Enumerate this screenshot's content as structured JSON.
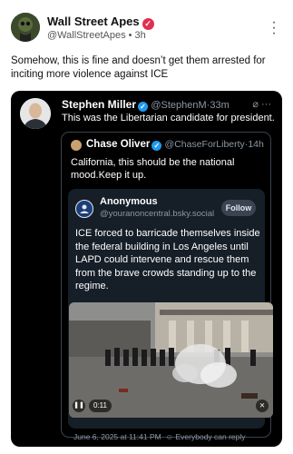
{
  "post": {
    "author_name": "Wall Street Apes",
    "author_handle": "@WallStreetApes",
    "age": "3h",
    "text": "Somehow, this is fine and doesn’t get them arrested for inciting more violence against ICE",
    "more_icon": "vertical-ellipsis-icon",
    "verified_icon": "verified-badge-icon"
  },
  "quote": {
    "author_name": "Stephen Miller",
    "author_handle": "@StephenM",
    "age": "33m",
    "text": "This was the Libertarian candidate for president.",
    "grok_icon": "grok-icon",
    "more_icon": "ellipsis-icon"
  },
  "nested": {
    "author_name": "Chase Oliver",
    "author_handle": "@ChaseForLiberty",
    "age": "14h",
    "text": "California, this should be the national mood.Keep it up."
  },
  "bsky": {
    "author_name": "Anonymous",
    "author_handle": "@youranoncentral.bsky.social",
    "follow_label": "Follow",
    "text": "ICE forced to barricade themselves inside the federal building in Los Angeles until LAPD could intervene and rescue them from the brave crowds standing up to the regime.",
    "video_time": "0:11",
    "timestamp": "June 6, 2025 at 11:41 PM",
    "reply_setting": "Everybody can reply"
  },
  "colors": {
    "verified_pink": "#e03050",
    "twitter_blue": "#1d9bf0",
    "card_bg": "#000000",
    "bsky_bg": "#161e27"
  }
}
